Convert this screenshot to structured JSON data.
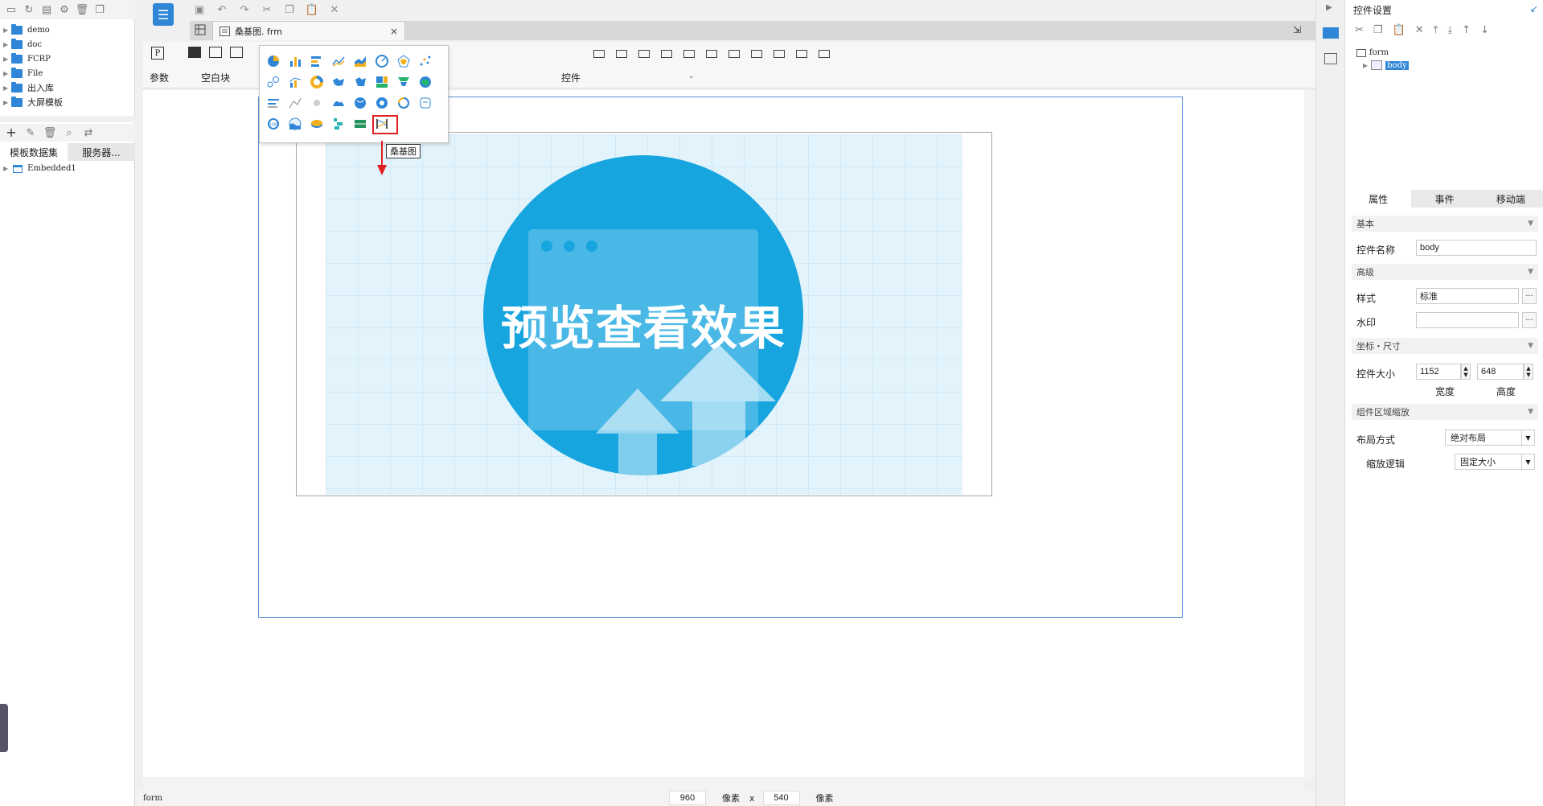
{
  "left_panel": {
    "tree": [
      {
        "label": "demo"
      },
      {
        "label": "doc"
      },
      {
        "label": "FCRP"
      },
      {
        "label": "File"
      },
      {
        "label": "出入库"
      },
      {
        "label": "大屏模板"
      }
    ],
    "tabs": [
      "模板数据集",
      "服务器..."
    ],
    "dataset": "Embedded1"
  },
  "doc_tab": {
    "title": "桑基图. frm",
    "close": "×"
  },
  "widget_bar": {
    "param_icon": "P",
    "param_label": "参数",
    "blank_label": "空白块",
    "controls_label": "控件"
  },
  "chart_popup": {
    "tooltip": "桑基图"
  },
  "canvas": {
    "preview_text": "预览查看效果"
  },
  "status_bar": {
    "form_label": "form",
    "width": "960",
    "unit1": "像素",
    "times": "x",
    "height": "540",
    "unit2": "像素"
  },
  "right_panel": {
    "title": "控件设置",
    "tree_root": "form",
    "tree_child": "body",
    "tabs": [
      "属性",
      "事件",
      "移动端"
    ],
    "sections": {
      "basic": "基本",
      "advanced": "高级",
      "position": "坐标・尺寸",
      "scaling": "组件区域缩放"
    },
    "props": {
      "name_label": "控件名称",
      "name_value": "body",
      "style_label": "样式",
      "style_value": "标准",
      "watermark_label": "水印",
      "watermark_value": "",
      "size_label": "控件大小",
      "width_value": "1152",
      "height_value": "648",
      "width_caption": "宽度",
      "height_caption": "高度",
      "layout_label": "布局方式",
      "layout_value": "绝对布局",
      "scale_label": "缩放逻辑",
      "scale_value": "固定大小"
    }
  },
  "colors": {
    "accent": "#2f86d6",
    "preview_blue": "#17a5df",
    "frame_blue": "#5b8fd9",
    "highlight_red": "#e02020"
  }
}
